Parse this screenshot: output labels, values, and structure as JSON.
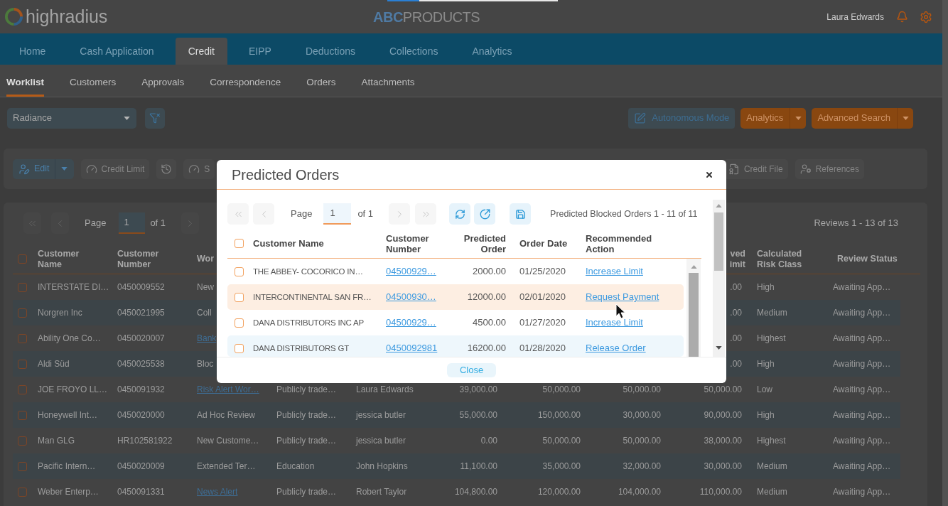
{
  "header": {
    "logo": "highradius",
    "brand": {
      "prefix": "ABC",
      "name": "PRODUCTS"
    },
    "user": "Laura Edwards"
  },
  "nav_tabs": [
    {
      "label": "Home",
      "selected": false
    },
    {
      "label": "Cash Application",
      "selected": false
    },
    {
      "label": "Credit",
      "selected": true
    },
    {
      "label": "EIPP",
      "selected": false
    },
    {
      "label": "Deductions",
      "selected": false
    },
    {
      "label": "Collections",
      "selected": false
    },
    {
      "label": "Analytics",
      "selected": false
    }
  ],
  "sub_tabs": [
    {
      "label": "Worklist",
      "selected": true
    },
    {
      "label": "Customers",
      "selected": false
    },
    {
      "label": "Approvals",
      "selected": false
    },
    {
      "label": "Correspondence",
      "selected": false
    },
    {
      "label": "Orders",
      "selected": false
    },
    {
      "label": "Attachments",
      "selected": false
    }
  ],
  "filter_bar": {
    "view_select": "Radiance",
    "buttons": [
      {
        "kind": "plain",
        "label": "Autonomous Mode"
      },
      {
        "kind": "split",
        "label": "Analytics"
      },
      {
        "kind": "split",
        "label": "Advanced Search"
      }
    ]
  },
  "action_bar": {
    "left": [
      {
        "kind": "split",
        "label": "Edit",
        "disabled": false
      },
      {
        "kind": "labeled",
        "label": "Credit Limit",
        "disabled": true
      },
      {
        "kind": "icon",
        "disabled": true
      },
      {
        "kind": "labeled",
        "label": "S",
        "disabled": true
      }
    ],
    "right": [
      {
        "kind": "labeled",
        "label": "Credit File",
        "disabled": true
      },
      {
        "kind": "labeled",
        "label": "References",
        "disabled": true
      }
    ]
  },
  "worklist": {
    "pager": {
      "nav_buttons": [
        {
          "disabled": true
        },
        {
          "disabled": true
        },
        {
          "disabled": true
        }
      ],
      "page_label": "Page",
      "page": "1",
      "page_count": "of 1",
      "summary": "Reviews 1 - 13 of 13"
    },
    "select_all": {
      "checked": false
    },
    "headers": {
      "customer_name": "Customer Name",
      "customer_number": "Customer Number",
      "column_3": "Wor",
      "column_9": "ved imit",
      "risk_class": "Calculated Risk Class",
      "review_status": "Review Status"
    },
    "rows": [
      {
        "checked": false,
        "customer_name": "INTERSTATE DI…",
        "customer_number": "0450009552",
        "column_3": {
          "kind": "text",
          "text": "New"
        },
        "column_9": ".00",
        "risk_class": "High",
        "review_status": "Awaiting App…"
      },
      {
        "checked": false,
        "customer_name": "Norgren Inc",
        "customer_number": "0450021995",
        "column_3": {
          "kind": "text",
          "text": "Coll"
        },
        "column_9": ".00",
        "risk_class": "Medium",
        "review_status": "Awaiting App…"
      },
      {
        "checked": false,
        "customer_name": "Ability One Co…",
        "customer_number": "0450020007",
        "column_3": {
          "kind": "link",
          "text": "Bank"
        },
        "column_9": ".00",
        "risk_class": "Highest",
        "review_status": "Awaiting App…"
      },
      {
        "checked": false,
        "customer_name": "Aldi Süd",
        "customer_number": "0450025538",
        "column_3": {
          "kind": "text",
          "text": "Bloc"
        },
        "column_9": ".00",
        "risk_class": "High",
        "review_status": "Awaiting App…"
      },
      {
        "checked": false,
        "customer_name": "JOE FROYO LL…",
        "customer_number": "0450091932",
        "column_3": {
          "kind": "link",
          "text": "Risk Alert Wor…"
        },
        "column_4": "Publicly trade…",
        "column_5": "Laura Edwards",
        "column_6": "39,000.00",
        "column_7": "50,000.00",
        "column_8": "50,000.00",
        "column_9": "50,000.00",
        "risk_class": "Low",
        "review_status": "Awaiting App…"
      },
      {
        "checked": false,
        "customer_name": "Honeywell Int…",
        "customer_number": "0450020000",
        "column_3": {
          "kind": "text",
          "text": "Ad Hoc Review"
        },
        "column_4": "Publicly trade…",
        "column_5": "jessica butler",
        "column_6": "55,000.00",
        "column_7": "150,000.00",
        "column_8": "30,000.00",
        "column_9": "90,000.00",
        "risk_class": "High",
        "review_status": "Awaiting App…"
      },
      {
        "checked": false,
        "customer_name": "Man GLG",
        "customer_number": "HR102581922",
        "column_3": {
          "kind": "text",
          "text": "New Custome…"
        },
        "column_4": "Publicly trade…",
        "column_5": "jessica butler",
        "column_6": "0.00",
        "column_7": "50,000.00",
        "column_8": "50,000.00",
        "column_9": "38,000.00",
        "risk_class": "Highest",
        "review_status": "Awaiting App…"
      },
      {
        "checked": false,
        "customer_name": "Pacific Intern…",
        "customer_number": "0450020009",
        "column_3": {
          "kind": "text",
          "text": "Extended Ter…"
        },
        "column_4": "Education",
        "column_5": "John Hopkins",
        "column_6": "11,100.00",
        "column_7": "35,000.00",
        "column_8": "32,000.00",
        "column_9": "30,000.00",
        "risk_class": "Medium",
        "review_status": "Awaiting App…"
      },
      {
        "checked": false,
        "customer_name": "Weber Enterp…",
        "customer_number": "0450091331",
        "column_3": {
          "kind": "link",
          "text": "News Alert"
        },
        "column_4": "Publicly trade…",
        "column_5": "Robert Taylor",
        "column_6": "104,800.00",
        "column_7": "120,000.00",
        "column_8": "104,000.00",
        "column_9": "110,000.00",
        "risk_class": "Medium",
        "review_status": "Awaiting App…"
      }
    ]
  },
  "modal": {
    "title": "Predicted Orders",
    "pager": {
      "nav_buttons": [
        {
          "disabled": true
        },
        {
          "disabled": true
        },
        {
          "disabled": true
        },
        {
          "disabled": true
        }
      ],
      "page_label": "Page",
      "page": "1",
      "page_count": "of 1",
      "summary": "Predicted Blocked Orders 1 - 11 of 11"
    },
    "select_all": {
      "checked": false
    },
    "headers": {
      "customer_name": "Customer Name",
      "customer_number": "Customer Number",
      "predicted_order": "Predicted Order",
      "order_date": "Order Date",
      "recommended_action": "Recommended Action"
    },
    "rows": [
      {
        "checked": false,
        "hovered": false,
        "customer_name": "THE ABBEY- COCORICO IN…",
        "customer_number": "04500929…",
        "predicted_order": "2000.00",
        "order_date": "01/25/2020",
        "recommended_action": "Increase Limit"
      },
      {
        "checked": false,
        "hovered": true,
        "customer_name": "INTERCONTINENTAL SAN FR…",
        "customer_number": "04500930…",
        "predicted_order": "12000.00",
        "order_date": "02/01/2020",
        "recommended_action": "Request Payment"
      },
      {
        "checked": false,
        "hovered": false,
        "customer_name": "DANA DISTRIBUTORS INC AP",
        "customer_number": "04500929…",
        "predicted_order": "4500.00",
        "order_date": "01/27/2020",
        "recommended_action": "Increase Limit"
      },
      {
        "checked": false,
        "hovered": false,
        "customer_name": "DANA DISTRIBUTORS GT",
        "customer_number": "0450092981",
        "predicted_order": "16200.00",
        "order_date": "01/28/2020",
        "recommended_action": "Release Order"
      }
    ],
    "close_button": "Close"
  }
}
